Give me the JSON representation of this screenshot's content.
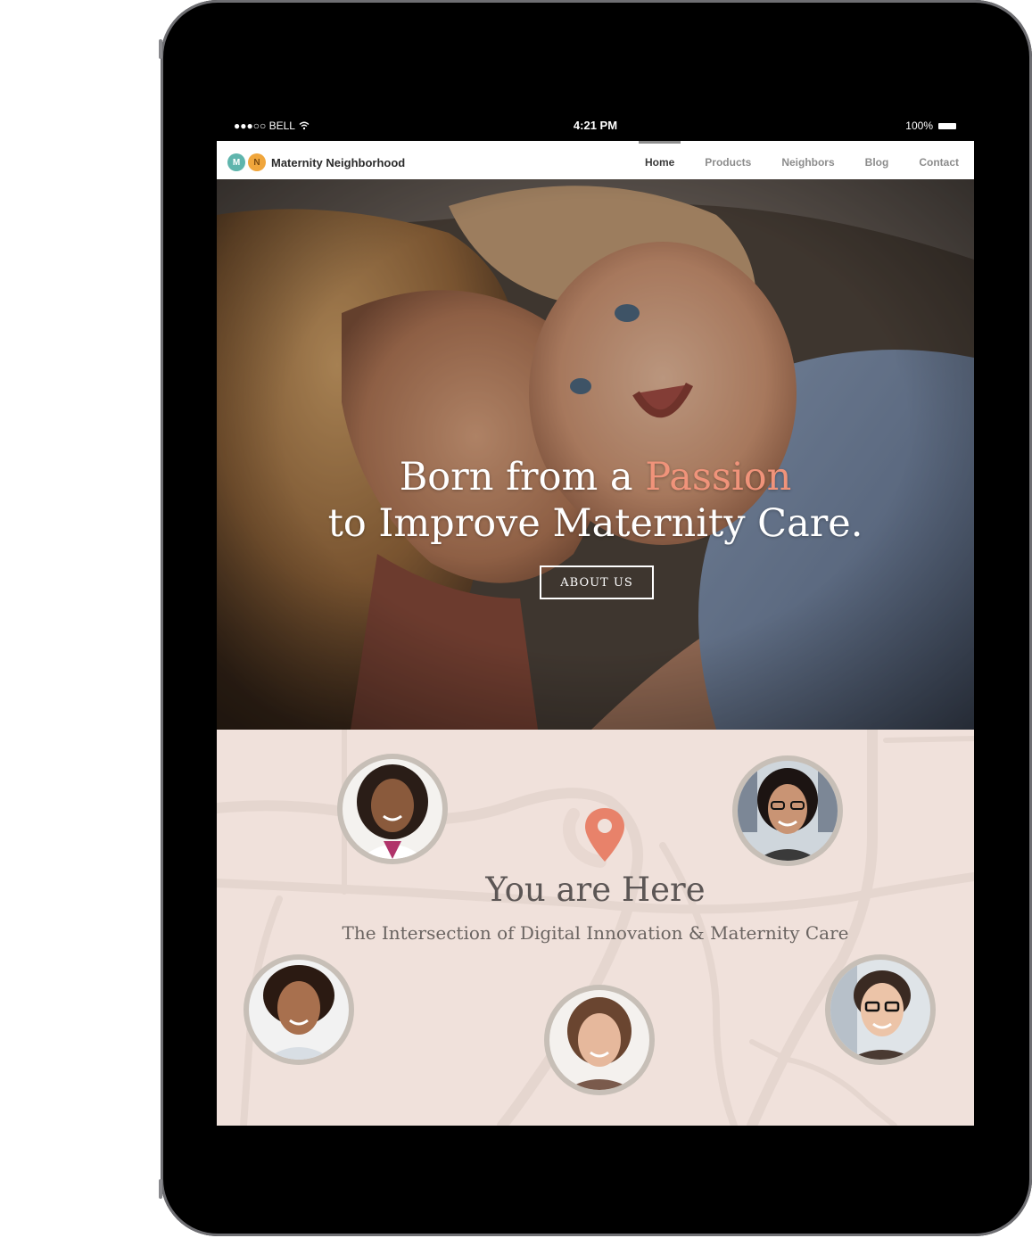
{
  "status_bar": {
    "carrier": "●●●○○ BELL",
    "time": "4:21 PM",
    "battery": "100%"
  },
  "brand": {
    "logo_m": "M",
    "logo_n": "N",
    "name": "Maternity Neighborhood",
    "colors": {
      "m": "#5fb5ad",
      "n": "#f0a63c",
      "accent": "#f0937a"
    }
  },
  "nav": {
    "items": [
      {
        "label": "Home",
        "active": true
      },
      {
        "label": "Products",
        "active": false
      },
      {
        "label": "Neighbors",
        "active": false
      },
      {
        "label": "Blog",
        "active": false
      },
      {
        "label": "Contact",
        "active": false
      }
    ]
  },
  "hero": {
    "line1_prefix": "Born from a ",
    "line1_accent": "Passion",
    "line2": "to Improve Maternity Care.",
    "button": "ABOUT US"
  },
  "map": {
    "title": "You are Here",
    "subtitle": "The Intersection of Digital Innovation & Maternity Care",
    "pin_color": "#e8826a",
    "avatars": [
      "neighbor-photo-1",
      "neighbor-photo-2",
      "neighbor-photo-3",
      "neighbor-photo-4",
      "neighbor-photo-5"
    ]
  }
}
